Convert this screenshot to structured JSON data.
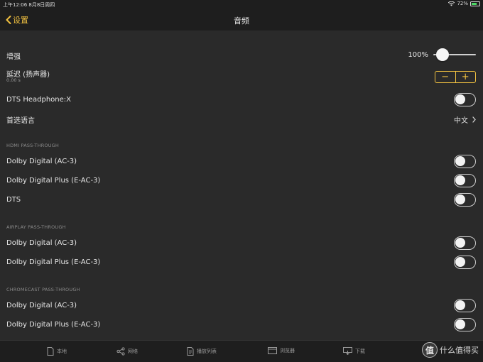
{
  "status_bar": {
    "time_date": "上午12:06   8月8日周四",
    "battery_percent": "72%",
    "battery_level": 0.72,
    "wifi_icon": "wifi-icon"
  },
  "nav": {
    "back_label": "设置",
    "title": "音频"
  },
  "settings": {
    "boost": {
      "label": "增强",
      "value": "100%",
      "slider_level": 1.0
    },
    "delay": {
      "label": "延迟 (扬声器)",
      "value": "0.00 s",
      "minus": "−",
      "plus": "+"
    },
    "dts_headphone": {
      "label": "DTS Headphone:X",
      "on": false
    },
    "language": {
      "label": "首选语言",
      "value": "中文"
    }
  },
  "sections": {
    "hdmi": {
      "header": "HDMI PASS-THROUGH",
      "items": [
        {
          "label": "Dolby Digital (AC-3)",
          "on": false
        },
        {
          "label": "Dolby Digital Plus (E-AC-3)",
          "on": false
        },
        {
          "label": "DTS",
          "on": false
        }
      ]
    },
    "airplay": {
      "header": "AIRPLAY PASS-THROUGH",
      "items": [
        {
          "label": "Dolby Digital (AC-3)",
          "on": false
        },
        {
          "label": "Dolby Digital Plus (E-AC-3)",
          "on": false
        }
      ]
    },
    "chromecast": {
      "header": "CHROMECAST PASS-THROUGH",
      "items": [
        {
          "label": "Dolby Digital (AC-3)",
          "on": false
        },
        {
          "label": "Dolby Digital Plus (E-AC-3)",
          "on": false
        }
      ]
    }
  },
  "tabbar": {
    "tabs": [
      {
        "label": "本地",
        "icon": "document-icon"
      },
      {
        "label": "网络",
        "icon": "share-network-icon"
      },
      {
        "label": "播放列表",
        "icon": "playlist-icon"
      },
      {
        "label": "浏览器",
        "icon": "browser-icon"
      },
      {
        "label": "下载",
        "icon": "download-icon"
      }
    ],
    "watermark": "什么值得买",
    "watermark_glyph": "值"
  },
  "colors": {
    "accent": "#f0c040",
    "background": "#2a2a2a",
    "bar": "#1e1e1e"
  }
}
